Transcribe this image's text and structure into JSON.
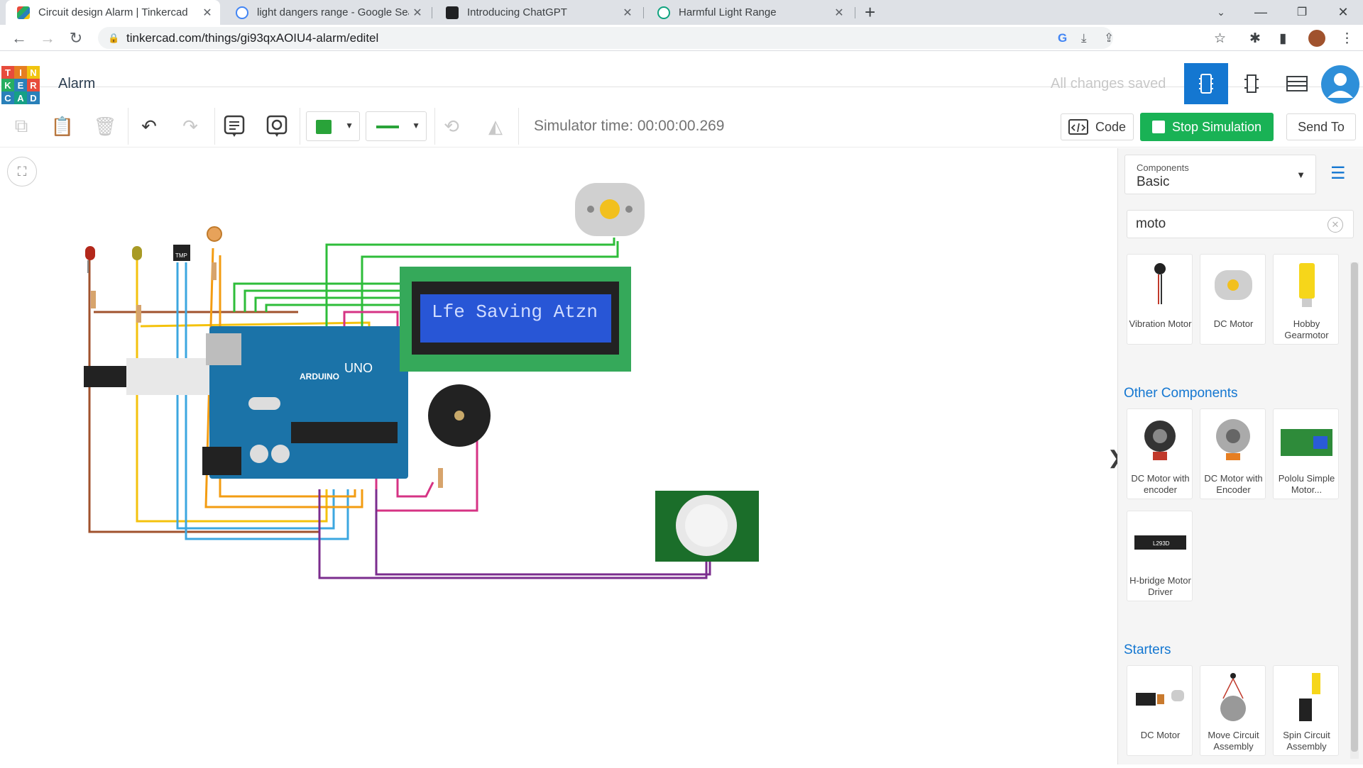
{
  "browser": {
    "tabs": [
      {
        "title": "Circuit design Alarm | Tinkercad",
        "active": true
      },
      {
        "title": "light dangers range - Google Sea",
        "active": false
      },
      {
        "title": "Introducing ChatGPT",
        "active": false
      },
      {
        "title": "Harmful Light Range",
        "active": false
      }
    ],
    "url": "tinkercad.com/things/gi93qxAOIU4-alarm/editel"
  },
  "header": {
    "logo_letters": [
      "T",
      "I",
      "N",
      "K",
      "E",
      "R",
      "C",
      "A",
      "D"
    ],
    "project_name": "Alarm",
    "save_status": "All changes saved"
  },
  "toolbar": {
    "simulator_time": "Simulator time: 00:00:00.269",
    "code_label": "Code",
    "stop_label": "Stop Simulation",
    "send_label": "Send To",
    "wire_color": "#29a339"
  },
  "canvas": {
    "lcd_text": "Lfe Saving Atzn",
    "arduino_brand": "ARDUINO",
    "arduino_model": "UNO",
    "sensor_label": "TMP"
  },
  "panel": {
    "components_label": "Components",
    "components_value": "Basic",
    "search_value": "moto",
    "results": [
      {
        "name": "Vibration Motor"
      },
      {
        "name": "DC Motor"
      },
      {
        "name": "Hobby Gearmotor"
      }
    ],
    "other_title": "Other Components",
    "other": [
      {
        "name": "DC Motor with encoder"
      },
      {
        "name": "DC Motor with Encoder"
      },
      {
        "name": "Pololu Simple Motor..."
      },
      {
        "name": "H-bridge Motor Driver"
      }
    ],
    "starters_title": "Starters",
    "starters": [
      {
        "name": "DC Motor"
      },
      {
        "name": "Move Circuit Assembly"
      },
      {
        "name": "Spin Circuit Assembly"
      }
    ]
  },
  "colors": {
    "accent": "#1477d1",
    "stop_green": "#19b255"
  }
}
